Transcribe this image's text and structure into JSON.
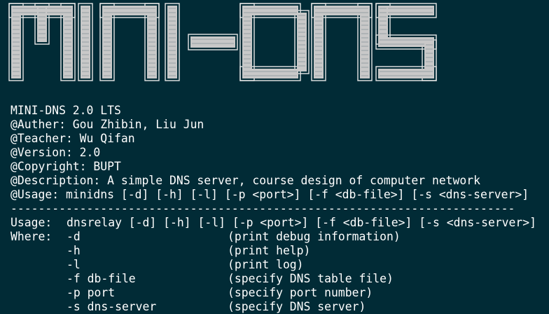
{
  "banner": {
    "logo_text": "MINI-DNS",
    "fill_color": "#c8c8c8",
    "edge_color": "#e6e6e6"
  },
  "info": {
    "title": "MINI-DNS 2.0 LTS",
    "author": "@Auther: Gou Zhibin, Liu Jun",
    "teacher": "@Teacher: Wu Qifan",
    "version": "@Version: 2.0",
    "copyright": "@Copyright: BUPT",
    "description": "@Description: A simple DNS server, course design of computer network",
    "usage": "@Usage: minidns [-d] [-h] [-l] [-p <port>] [-f <db-file>] [-s <dns-server>]"
  },
  "separator": "-------------------------------------------------------------------------",
  "help": {
    "usage_label": "Usage:",
    "usage_cmd": "dnsrelay [-d] [-h] [-l] [-p <port>] [-f <db-file>] [-s <dns-server>]",
    "where_label": "Where:",
    "options": [
      {
        "flag": "-d",
        "desc": "(print debug information)"
      },
      {
        "flag": "-h",
        "desc": "(print help)"
      },
      {
        "flag": "-l",
        "desc": "(print log)"
      },
      {
        "flag": "-f db-file",
        "desc": "(specify DNS table file)"
      },
      {
        "flag": "-p port",
        "desc": "(specify port number)"
      },
      {
        "flag": "-s dns-server",
        "desc": "(specify DNS server)"
      }
    ]
  },
  "colors": {
    "background": "#012b36",
    "text": "#ffffff"
  }
}
